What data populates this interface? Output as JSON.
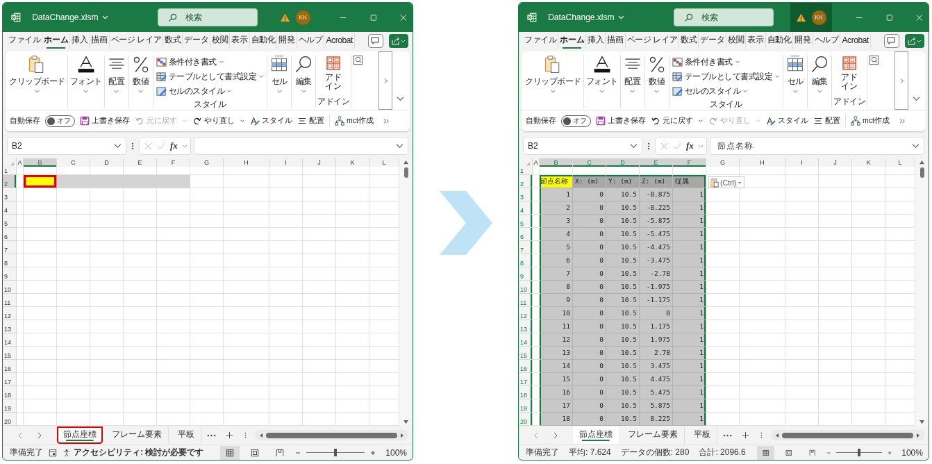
{
  "windows": [
    {
      "title": "DataChange.xlsm",
      "search": {
        "placeholder": "検索"
      },
      "avatar": "KK",
      "account_highlighted": false,
      "menu_tabs": [
        {
          "label": "ファイル",
          "selected": false
        },
        {
          "label": "ホーム",
          "selected": true
        },
        {
          "label": "挿入",
          "selected": false
        },
        {
          "label": "描画",
          "selected": false
        },
        {
          "label": "ページ レイア",
          "selected": false
        },
        {
          "label": "数式",
          "selected": false
        },
        {
          "label": "データ",
          "selected": false
        },
        {
          "label": "校閲",
          "selected": false
        },
        {
          "label": "表示",
          "selected": false
        },
        {
          "label": "自動化",
          "selected": false
        },
        {
          "label": "開発",
          "selected": false
        },
        {
          "label": "ヘルプ",
          "selected": false
        },
        {
          "label": "Acrobat",
          "selected": false
        }
      ],
      "ribbon_groups": [
        {
          "kind": "large",
          "label": "クリップボード"
        },
        {
          "kind": "large",
          "label": "フォント"
        },
        {
          "kind": "large",
          "label": "配置"
        },
        {
          "kind": "large",
          "label": "数値"
        },
        {
          "kind": "stack",
          "label": "スタイル",
          "items": [
            {
              "label": "条件付き書式"
            },
            {
              "label": "テーブルとして書式設定"
            },
            {
              "label": "セルのスタイル"
            }
          ]
        },
        {
          "kind": "large",
          "label": "セル"
        },
        {
          "kind": "large",
          "label": "編集"
        },
        {
          "kind": "titled",
          "button": "アドイン",
          "label": "アドイン"
        }
      ],
      "autosave": {
        "label": "自動保存",
        "state": "オフ",
        "on": false
      },
      "toolbar": [
        {
          "kind": "save",
          "label": "上書き保存",
          "disabled": false
        },
        {
          "kind": "undo",
          "label": "元に戻す",
          "disabled": true
        },
        {
          "kind": "redo",
          "label": "やり直し",
          "disabled": false
        },
        {
          "kind": "style",
          "label": "スタイル",
          "disabled": false
        },
        {
          "kind": "align",
          "label": "配置",
          "disabled": false
        },
        {
          "kind": "mct",
          "label": "mct作成",
          "disabled": false
        }
      ],
      "formula_bar": {
        "name_box": "B2",
        "insert_function": "fx"
      },
      "grid": {
        "selection_outline": false,
        "callout": true,
        "columns": [
          {
            "label": "A",
            "selected": false
          },
          {
            "label": "B",
            "selected": true
          },
          {
            "label": "C",
            "selected": false
          },
          {
            "label": "D",
            "selected": false
          },
          {
            "label": "E",
            "selected": false
          },
          {
            "label": "F",
            "selected": false
          },
          {
            "label": "G",
            "selected": false
          },
          {
            "label": "H",
            "selected": false
          },
          {
            "label": "I",
            "selected": false
          },
          {
            "label": "J",
            "selected": false
          },
          {
            "label": "K",
            "selected": false
          },
          {
            "label": "L",
            "selected": false
          }
        ],
        "rows": [
          {
            "header": "1",
            "selected": false,
            "kind": "blank"
          },
          {
            "header": "2",
            "selected": true,
            "kind": "header"
          },
          {
            "header": "3",
            "selected": false,
            "kind": "blank"
          },
          {
            "header": "4",
            "selected": false,
            "kind": "blank"
          },
          {
            "header": "5",
            "selected": false,
            "kind": "blank"
          },
          {
            "header": "6",
            "selected": false,
            "kind": "blank"
          },
          {
            "header": "7",
            "selected": false,
            "kind": "blank"
          },
          {
            "header": "8",
            "selected": false,
            "kind": "blank"
          },
          {
            "header": "9",
            "selected": false,
            "kind": "blank"
          },
          {
            "header": "10",
            "selected": false,
            "kind": "blank"
          },
          {
            "header": "11",
            "selected": false,
            "kind": "blank"
          },
          {
            "header": "12",
            "selected": false,
            "kind": "blank"
          },
          {
            "header": "13",
            "selected": false,
            "kind": "blank"
          },
          {
            "header": "14",
            "selected": false,
            "kind": "blank"
          },
          {
            "header": "15",
            "selected": false,
            "kind": "blank"
          },
          {
            "header": "16",
            "selected": false,
            "kind": "blank"
          },
          {
            "header": "17",
            "selected": false,
            "kind": "blank"
          },
          {
            "header": "18",
            "selected": false,
            "kind": "blank"
          },
          {
            "header": "19",
            "selected": false,
            "kind": "blank"
          },
          {
            "header": "20",
            "selected": false,
            "kind": "blank"
          }
        ]
      },
      "sheet_tabs": [
        {
          "label": "節点座標",
          "selected": true,
          "callout": true
        },
        {
          "label": "フレーム要素",
          "selected": false,
          "callout": false
        },
        {
          "label": "平板",
          "selected": false,
          "callout": false
        }
      ],
      "status": {
        "ready": "準備完了",
        "accessibility": "アクセシビリティ: 検討が必要です"
      },
      "zoom": {
        "level": 0.5,
        "label": "100%"
      }
    },
    {
      "title": "DataChange.xlsm",
      "search": {
        "placeholder": "検索"
      },
      "avatar": "KK",
      "account_highlighted": true,
      "menu_tabs": [
        {
          "label": "ファイル",
          "selected": false
        },
        {
          "label": "ホーム",
          "selected": true
        },
        {
          "label": "挿入",
          "selected": false
        },
        {
          "label": "描画",
          "selected": false
        },
        {
          "label": "ページ レイア",
          "selected": false
        },
        {
          "label": "数式",
          "selected": false
        },
        {
          "label": "データ",
          "selected": false
        },
        {
          "label": "校閲",
          "selected": false
        },
        {
          "label": "表示",
          "selected": false
        },
        {
          "label": "自動化",
          "selected": false
        },
        {
          "label": "開発",
          "selected": false
        },
        {
          "label": "ヘルプ",
          "selected": false
        },
        {
          "label": "Acrobat",
          "selected": false
        }
      ],
      "ribbon_groups": [
        {
          "kind": "large",
          "label": "クリップボード"
        },
        {
          "kind": "large",
          "label": "フォント"
        },
        {
          "kind": "large",
          "label": "配置"
        },
        {
          "kind": "large",
          "label": "数値"
        },
        {
          "kind": "stack",
          "label": "スタイル",
          "items": [
            {
              "label": "条件付き書式"
            },
            {
              "label": "テーブルとして書式設定"
            },
            {
              "label": "セルのスタイル"
            }
          ]
        },
        {
          "kind": "large",
          "label": "セル"
        },
        {
          "kind": "large",
          "label": "編集"
        },
        {
          "kind": "titled",
          "button": "アドイン",
          "label": "アドイン"
        }
      ],
      "autosave": {
        "label": "自動保存",
        "state": "オフ",
        "on": false
      },
      "toolbar": [
        {
          "kind": "save",
          "label": "上書き保存",
          "disabled": false
        },
        {
          "kind": "undo",
          "label": "元に戻す",
          "disabled": false
        },
        {
          "kind": "redo",
          "label": "やり直し",
          "disabled": true
        },
        {
          "kind": "style",
          "label": "スタイル",
          "disabled": false
        },
        {
          "kind": "align",
          "label": "配置",
          "disabled": false
        },
        {
          "kind": "mct",
          "label": "mct作成",
          "disabled": false
        }
      ],
      "formula_bar": {
        "name_box": "B2",
        "insert_function": "fx",
        "value": "節点名称"
      },
      "grid": {
        "selection_outline": true,
        "callout": false,
        "paste_options": "(Ctrl)",
        "columns": [
          {
            "label": "A",
            "selected": false
          },
          {
            "label": "B",
            "selected": true
          },
          {
            "label": "C",
            "selected": true
          },
          {
            "label": "D",
            "selected": true
          },
          {
            "label": "E",
            "selected": true
          },
          {
            "label": "F",
            "selected": true
          },
          {
            "label": "G",
            "selected": false
          },
          {
            "label": "H",
            "selected": false
          },
          {
            "label": "I",
            "selected": false
          },
          {
            "label": "J",
            "selected": false
          },
          {
            "label": "K",
            "selected": false
          },
          {
            "label": "L",
            "selected": false
          }
        ],
        "rows": [
          {
            "header": "1",
            "selected": false,
            "kind": "blank"
          },
          {
            "header": "2",
            "selected": true,
            "kind": "header",
            "values": [
              "節点名称",
              "X: (m)",
              "Y: (m)",
              "Z: (m)",
              "従属"
            ]
          },
          {
            "header": "3",
            "selected": true,
            "kind": "data",
            "values": [
              "1",
              "0",
              "10.5",
              "-8.875",
              "1"
            ]
          },
          {
            "header": "4",
            "selected": true,
            "kind": "data",
            "values": [
              "2",
              "0",
              "10.5",
              "-8.225",
              "1"
            ]
          },
          {
            "header": "5",
            "selected": true,
            "kind": "data",
            "values": [
              "3",
              "0",
              "10.5",
              "-5.875",
              "1"
            ]
          },
          {
            "header": "6",
            "selected": true,
            "kind": "data",
            "values": [
              "4",
              "0",
              "10.5",
              "-5.475",
              "1"
            ]
          },
          {
            "header": "7",
            "selected": true,
            "kind": "data",
            "values": [
              "5",
              "0",
              "10.5",
              "-4.475",
              "1"
            ]
          },
          {
            "header": "8",
            "selected": true,
            "kind": "data",
            "values": [
              "6",
              "0",
              "10.5",
              "-3.475",
              "1"
            ]
          },
          {
            "header": "9",
            "selected": true,
            "kind": "data",
            "values": [
              "7",
              "0",
              "10.5",
              "-2.78",
              "1"
            ]
          },
          {
            "header": "10",
            "selected": true,
            "kind": "data",
            "values": [
              "8",
              "0",
              "10.5",
              "-1.975",
              "1"
            ]
          },
          {
            "header": "11",
            "selected": true,
            "kind": "data",
            "values": [
              "9",
              "0",
              "10.5",
              "-1.175",
              "1"
            ]
          },
          {
            "header": "12",
            "selected": true,
            "kind": "data",
            "values": [
              "10",
              "0",
              "10.5",
              "0",
              "1"
            ]
          },
          {
            "header": "13",
            "selected": true,
            "kind": "data",
            "values": [
              "11",
              "0",
              "10.5",
              "1.175",
              "1"
            ]
          },
          {
            "header": "14",
            "selected": true,
            "kind": "data",
            "values": [
              "12",
              "0",
              "10.5",
              "1.975",
              "1"
            ]
          },
          {
            "header": "15",
            "selected": true,
            "kind": "data",
            "values": [
              "13",
              "0",
              "10.5",
              "2.78",
              "1"
            ]
          },
          {
            "header": "16",
            "selected": true,
            "kind": "data",
            "values": [
              "14",
              "0",
              "10.5",
              "3.475",
              "1"
            ]
          },
          {
            "header": "17",
            "selected": true,
            "kind": "data",
            "values": [
              "15",
              "0",
              "10.5",
              "4.475",
              "1"
            ]
          },
          {
            "header": "18",
            "selected": true,
            "kind": "data",
            "values": [
              "16",
              "0",
              "10.5",
              "5.475",
              "1"
            ]
          },
          {
            "header": "19",
            "selected": true,
            "kind": "data",
            "values": [
              "17",
              "0",
              "10.5",
              "5.875",
              "1"
            ]
          },
          {
            "header": "20",
            "selected": true,
            "kind": "data",
            "values": [
              "18",
              "0",
              "10.5",
              "8.225",
              "1"
            ]
          }
        ]
      },
      "sheet_tabs": [
        {
          "label": "節点座標",
          "selected": true,
          "callout": false
        },
        {
          "label": "フレーム要素",
          "selected": false,
          "callout": false
        },
        {
          "label": "平板",
          "selected": false,
          "callout": false
        }
      ],
      "status": {
        "ready": "準備完了",
        "stats": [
          "平均: 7.624",
          "データの個数: 280",
          "合計: 2096.6"
        ]
      },
      "zoom": {
        "level": 0.5,
        "label": "100%"
      }
    }
  ]
}
